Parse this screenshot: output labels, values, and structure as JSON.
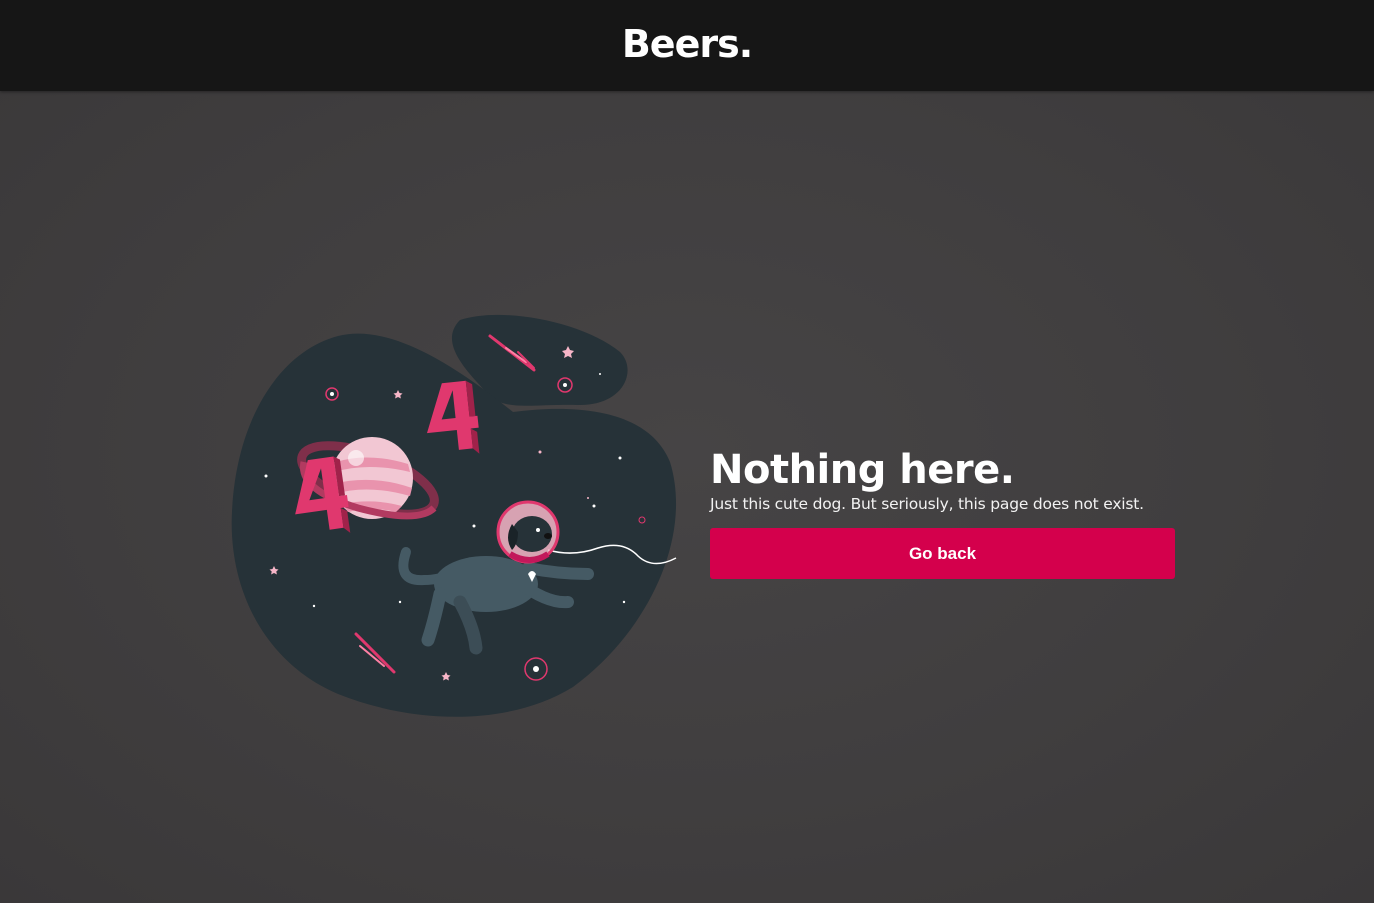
{
  "header": {
    "brand": "Beers."
  },
  "illustration": {
    "icon": "astronaut-dog-404-illustration",
    "digits": [
      "4",
      "4"
    ]
  },
  "main": {
    "title": "Nothing here.",
    "subtitle": "Just this cute dog. But seriously, this page does not exist.",
    "button_label": "Go back"
  },
  "colors": {
    "header_bg": "#161616",
    "page_bg": "#434142",
    "accent": "#d4004c",
    "blob": "#263238",
    "pink": "#e0386e"
  }
}
